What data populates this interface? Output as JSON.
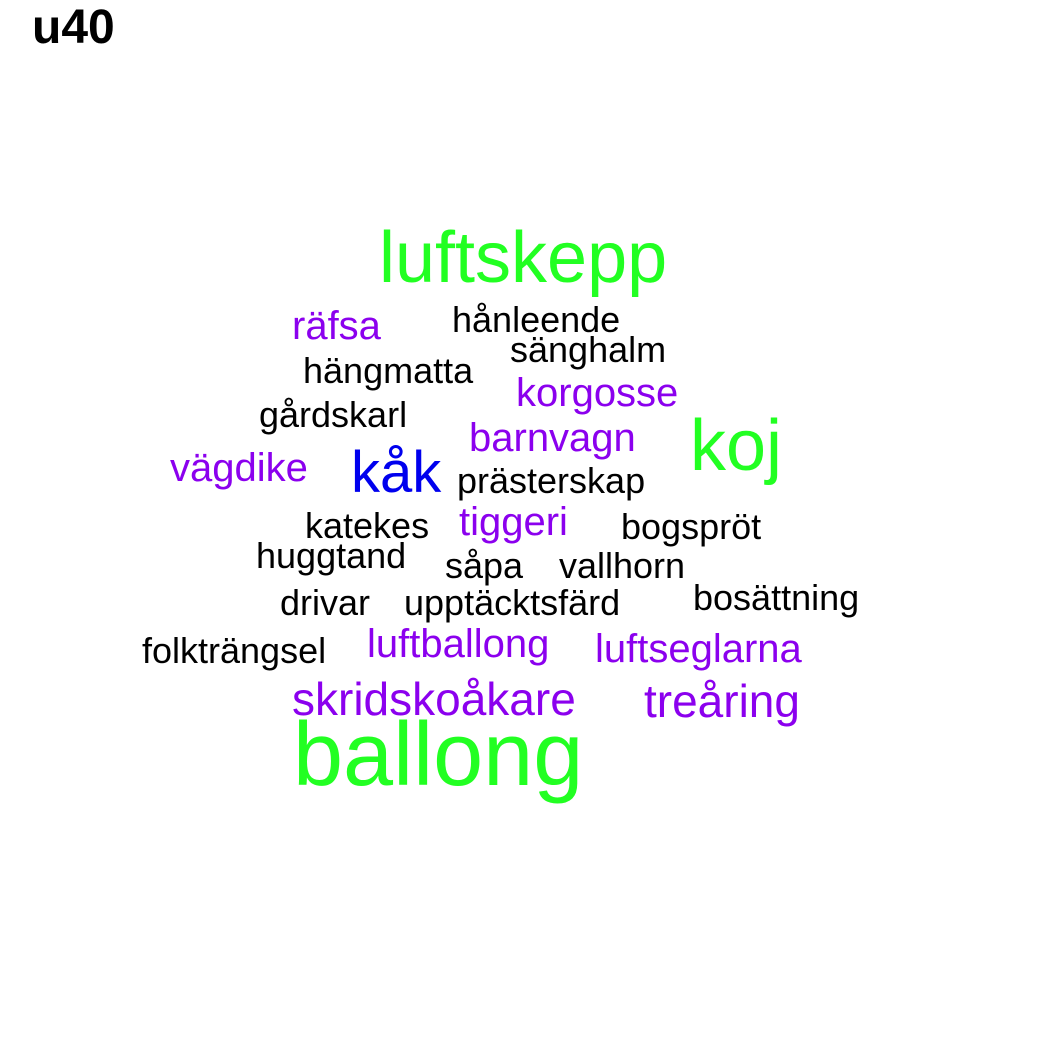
{
  "title": "u40",
  "colors": {
    "green": "#22ff22",
    "blue": "#0000ee",
    "purple": "#8b00ee",
    "black": "#000000"
  },
  "words": [
    {
      "text": "luftskepp",
      "color": "green"
    },
    {
      "text": "räfsa",
      "color": "purple"
    },
    {
      "text": "hånleende",
      "color": "black"
    },
    {
      "text": "sänghalm",
      "color": "black"
    },
    {
      "text": "hängmatta",
      "color": "black"
    },
    {
      "text": "korgosse",
      "color": "purple"
    },
    {
      "text": "gårdskarl",
      "color": "black"
    },
    {
      "text": "barnvagn",
      "color": "purple"
    },
    {
      "text": "koj",
      "color": "green"
    },
    {
      "text": "vägdike",
      "color": "purple"
    },
    {
      "text": "kåk",
      "color": "blue"
    },
    {
      "text": "prästerskap",
      "color": "black"
    },
    {
      "text": "katekes",
      "color": "black"
    },
    {
      "text": "tiggeri",
      "color": "purple"
    },
    {
      "text": "bogspröt",
      "color": "black"
    },
    {
      "text": "huggtand",
      "color": "black"
    },
    {
      "text": "såpa",
      "color": "black"
    },
    {
      "text": "vallhorn",
      "color": "black"
    },
    {
      "text": "drivar",
      "color": "black"
    },
    {
      "text": "upptäcktsfärd",
      "color": "black"
    },
    {
      "text": "bosättning",
      "color": "black"
    },
    {
      "text": "folkträngsel",
      "color": "black"
    },
    {
      "text": "luftballong",
      "color": "purple"
    },
    {
      "text": "luftseglarna",
      "color": "purple"
    },
    {
      "text": "skridskoåkare",
      "color": "purple"
    },
    {
      "text": "treåring",
      "color": "purple"
    },
    {
      "text": "ballong",
      "color": "green"
    }
  ]
}
